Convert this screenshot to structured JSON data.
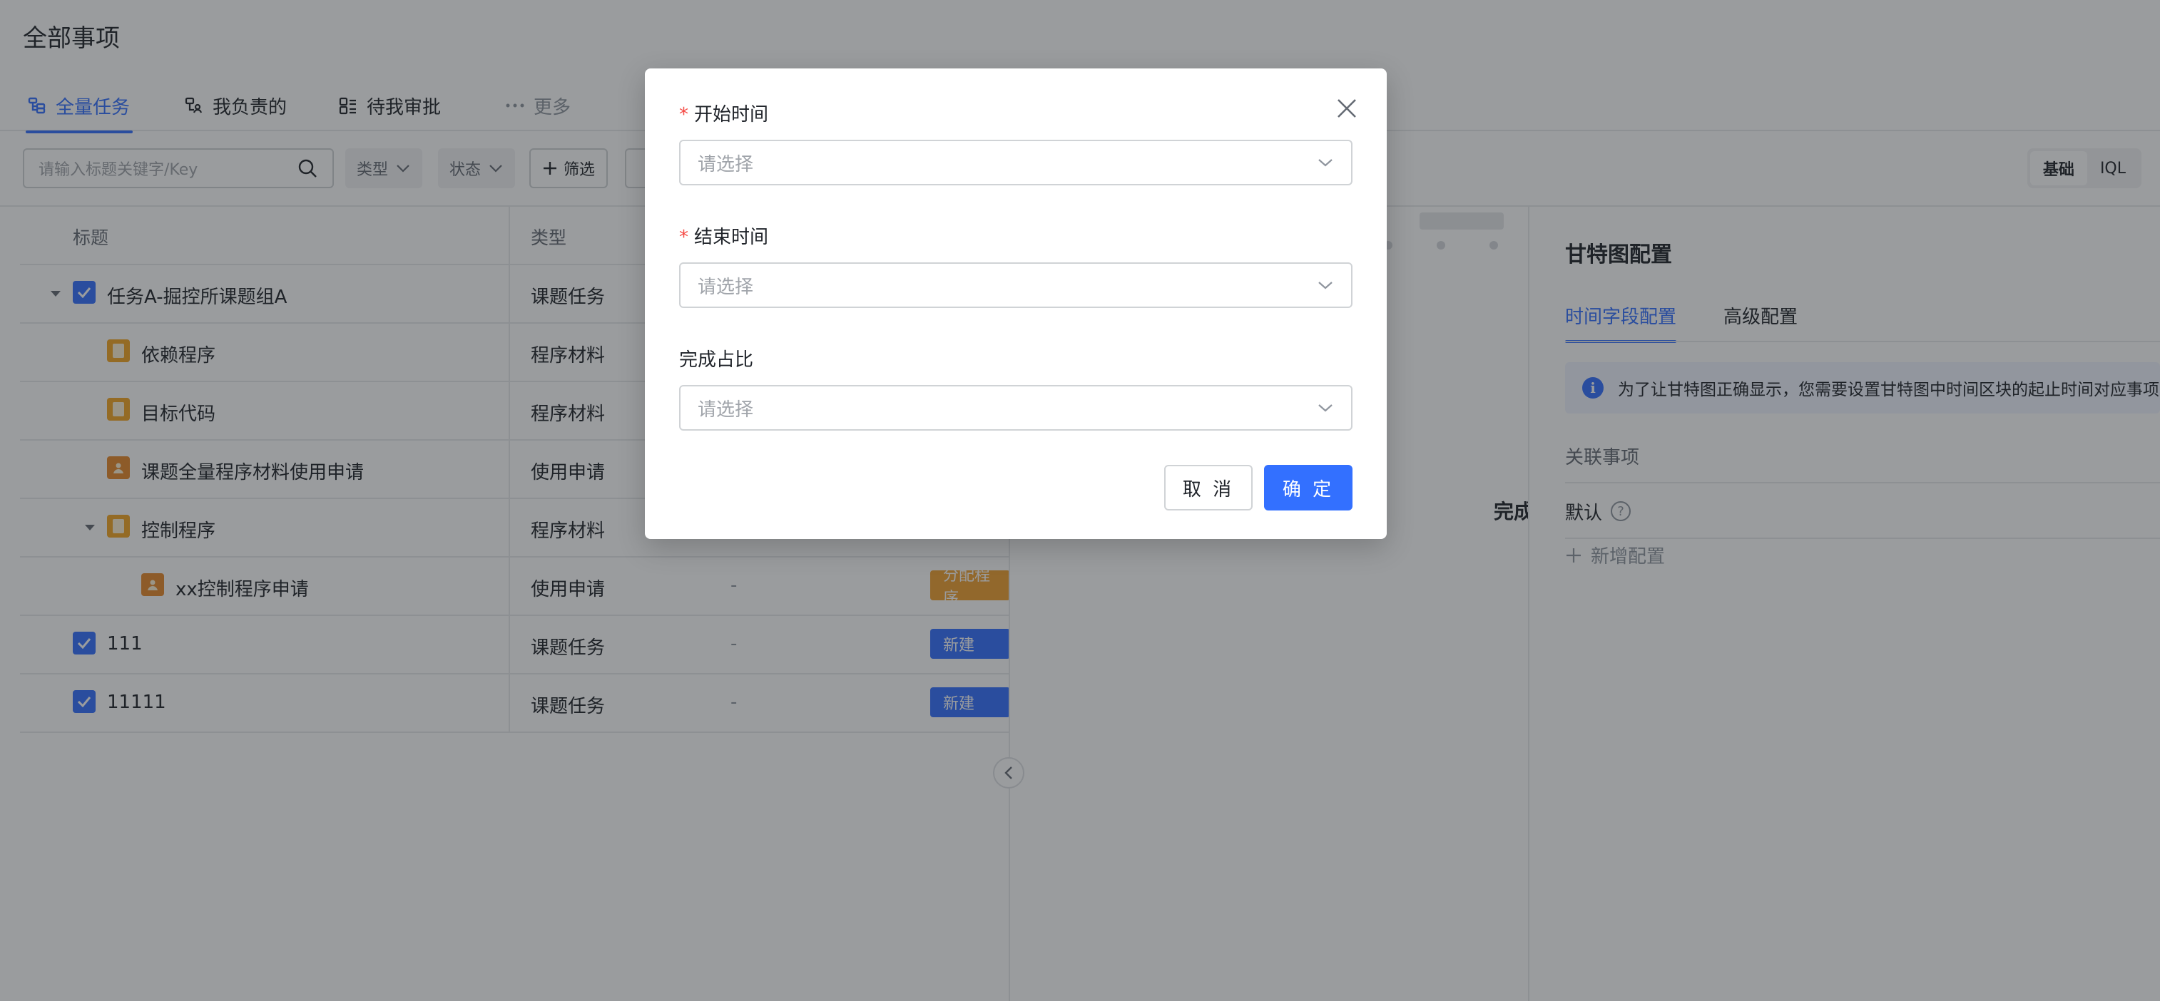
{
  "page": {
    "title": "全部事项"
  },
  "tabs": [
    {
      "label": "全量任务",
      "icon": "tree-list-icon"
    },
    {
      "label": "我负责的",
      "icon": "person-tree-icon"
    },
    {
      "label": "待我审批",
      "icon": "approval-list-icon"
    },
    {
      "label": "更多",
      "icon": "more-dots-icon"
    }
  ],
  "toolbar": {
    "search_placeholder": "请输入标题关键字/Key",
    "type_filter": "类型",
    "status_filter": "状态",
    "filter_button": "筛选",
    "mode_basic": "基础",
    "mode_iql": "IQL"
  },
  "table": {
    "headers": {
      "title": "标题",
      "type": "类型"
    },
    "rows": [
      {
        "title": "任务A-掘控所课题组A",
        "type": "课题任务",
        "owner": "",
        "status": ""
      },
      {
        "title": "依赖程序",
        "type": "程序材料",
        "owner": "",
        "status": ""
      },
      {
        "title": "目标代码",
        "type": "程序材料",
        "owner": "",
        "status": ""
      },
      {
        "title": "课题全量程序材料使用申请",
        "type": "使用申请",
        "owner": "",
        "status": ""
      },
      {
        "title": "控制程序",
        "type": "程序材料",
        "owner": "",
        "status": ""
      },
      {
        "title": "xx控制程序申请",
        "type": "使用申请",
        "owner": "-",
        "status": "分配程序"
      },
      {
        "title": "111",
        "type": "课题任务",
        "owner": "-",
        "status": "新建"
      },
      {
        "title": "11111",
        "type": "课题任务",
        "owner": "-",
        "status": "新建"
      }
    ]
  },
  "gantt": {
    "partial_label": "完成"
  },
  "config_panel": {
    "title": "甘特图配置",
    "tabs": [
      "时间字段配置",
      "高级配置"
    ],
    "notice": "为了让甘特图正确显示，您需要设置甘特图中时间区块的起止时间对应事项的",
    "row1_label": "关联事项",
    "row2_label": "默认",
    "add_label": "新增配置"
  },
  "modal": {
    "fields": [
      {
        "label": "开始时间",
        "required": "*",
        "placeholder": "请选择"
      },
      {
        "label": "结束时间",
        "required": "*",
        "placeholder": "请选择"
      },
      {
        "label": "完成占比",
        "placeholder": "请选择"
      }
    ],
    "cancel": "取 消",
    "confirm": "确 定"
  },
  "colors": {
    "accent": "#3370ff",
    "required": "#f54a45",
    "status_orange": "#f0a030"
  }
}
